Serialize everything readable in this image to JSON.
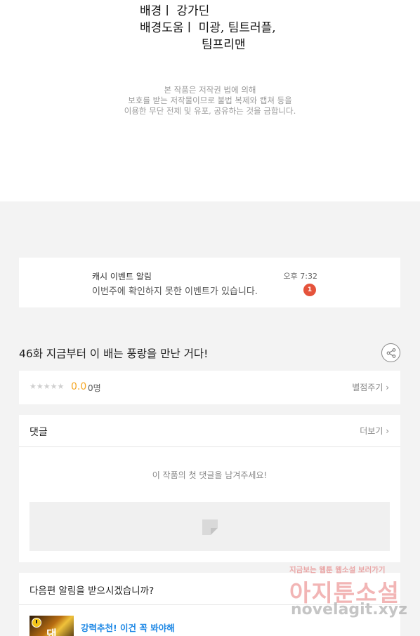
{
  "credits": {
    "line1": "배경ㅣ  강가딘",
    "line2": "배경도움ㅣ  미광, 팀트러플,",
    "line3": "팀프리맨"
  },
  "notice": {
    "line1": "본 작품은 저작권 법에 의해",
    "line2": "보호를 받는 저작물이므로 불법 복제와 캡쳐 등을",
    "line3": "이용한 무단 전제 및 유포, 공유하는 것을 금합니다."
  },
  "notification": {
    "title": "캐시 이벤트 알림",
    "message": "이번주에 확인하지 못한 이벤트가 있습니다.",
    "time": "오후 7:32",
    "badge_count": "1"
  },
  "episode": {
    "title": "46화 지금부터 이 배는 풍랑을 만난 거다!"
  },
  "rating": {
    "stars": "★★★★★",
    "score": "0.0",
    "count": "0명",
    "rate_link": "별점주기 ›"
  },
  "comments": {
    "header": "댓글",
    "more_link": "더보기 ›",
    "empty_message": "이 작품의 첫 댓글을 남겨주세요!"
  },
  "next_episode": {
    "question": "다음편 알림을 받으시겠습니까?",
    "recommendation": "강력추천! 이건 꼭 봐야해",
    "thumbnail_glyph": "댄"
  },
  "watermark": {
    "top": "지금보는 웹툰 웹소설 보러가기",
    "main": "아지툰소설",
    "url": "novelagit.xyz"
  },
  "colors": {
    "page_background": "#f3f3f3",
    "badge": "#e5533b",
    "score": "#f5a623",
    "link_blue": "#1e88e5"
  }
}
